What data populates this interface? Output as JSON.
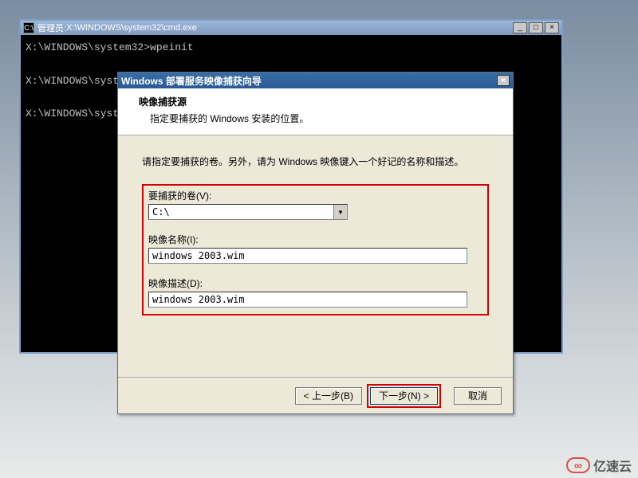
{
  "cmd": {
    "title_prefix": "管理员: ",
    "title_path": "X:\\WINDOWS\\system32\\cmd.exe",
    "icon_label": "C:\\",
    "lines": "X:\\WINDOWS\\system32>wpeinit\n\nX:\\WINDOWS\\syst\n\nX:\\WINDOWS\\syst"
  },
  "wizard": {
    "title": "Windows 部署服务映像捕获向导",
    "header_title": "映像捕获源",
    "header_sub": "指定要捕获的 Windows 安装的位置。",
    "instruction": "请指定要捕获的卷。另外，请为 Windows 映像键入一个好记的名称和描述。",
    "volume_label": "要捕获的卷(V):",
    "volume_value": "C:\\",
    "imagename_label": "映像名称(I):",
    "imagename_value": "windows 2003.wim",
    "imagedesc_label": "映像描述(D):",
    "imagedesc_value": "windows 2003.wim",
    "back_label": "< 上一步(B)",
    "next_label": "下一步(N) >",
    "cancel_label": "取消"
  },
  "watermark": {
    "symbol": "∞",
    "text": "亿速云"
  }
}
